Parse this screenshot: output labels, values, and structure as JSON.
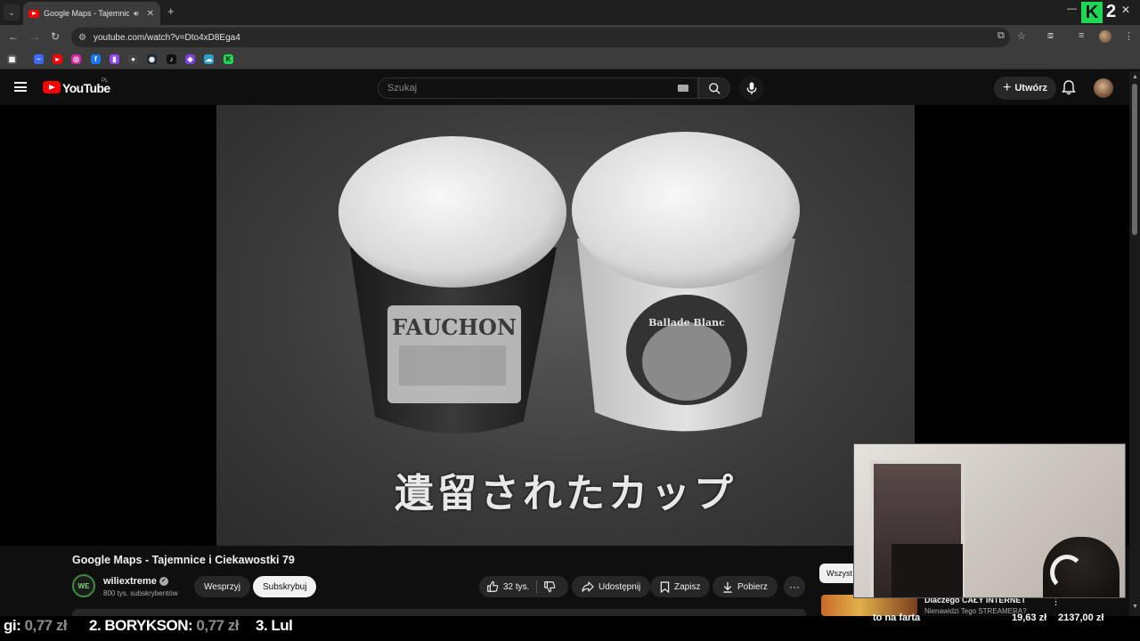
{
  "browser": {
    "tab_title": "Google Maps - Tajemnice i",
    "url": "youtube.com/watch?v=Dto4xD8Ega4",
    "overlay_brand_number": "2",
    "overlay_brand_letter": "K"
  },
  "youtube": {
    "logo_text": "YouTube",
    "country_code": "PL",
    "search_placeholder": "Szukaj",
    "create_label": "Utwórz"
  },
  "video": {
    "subtitle": "遺留されたカップ",
    "cup_left_label": "FAUCHON",
    "cup_right_label": "Ballade Blanc",
    "title": "Google Maps - Tajemnice i Ciekawostki 79",
    "channel_name": "wiliextreme",
    "channel_initials": "WE",
    "subscribers": "800 tys. subskrybentów",
    "support_label": "Wesprzyj",
    "subscribe_label": "Subskrybuj",
    "likes": "32 tys.",
    "share_label": "Udostępnij",
    "save_label": "Zapisz",
    "download_label": "Pobierz"
  },
  "sidebar": {
    "chip_label": "Wszyst",
    "rec_title": "Dlaczego CAŁY INTERNET",
    "rec_subtitle": "Nienawidzi Tego STREAMERA?"
  },
  "ticker": {
    "item0_name": "gi:",
    "item0_amount": "0,77 zł",
    "item1_name": "2. BORYKSON:",
    "item1_amount": "0,77 zł",
    "item2_name": "3. Lul",
    "note": "to na farta",
    "current": "19,63 zł",
    "total": "2137,00 zł"
  },
  "colors": {
    "accent_red": "#ff0000",
    "k_green": "#1fd655",
    "background": "#0f0f0f"
  }
}
